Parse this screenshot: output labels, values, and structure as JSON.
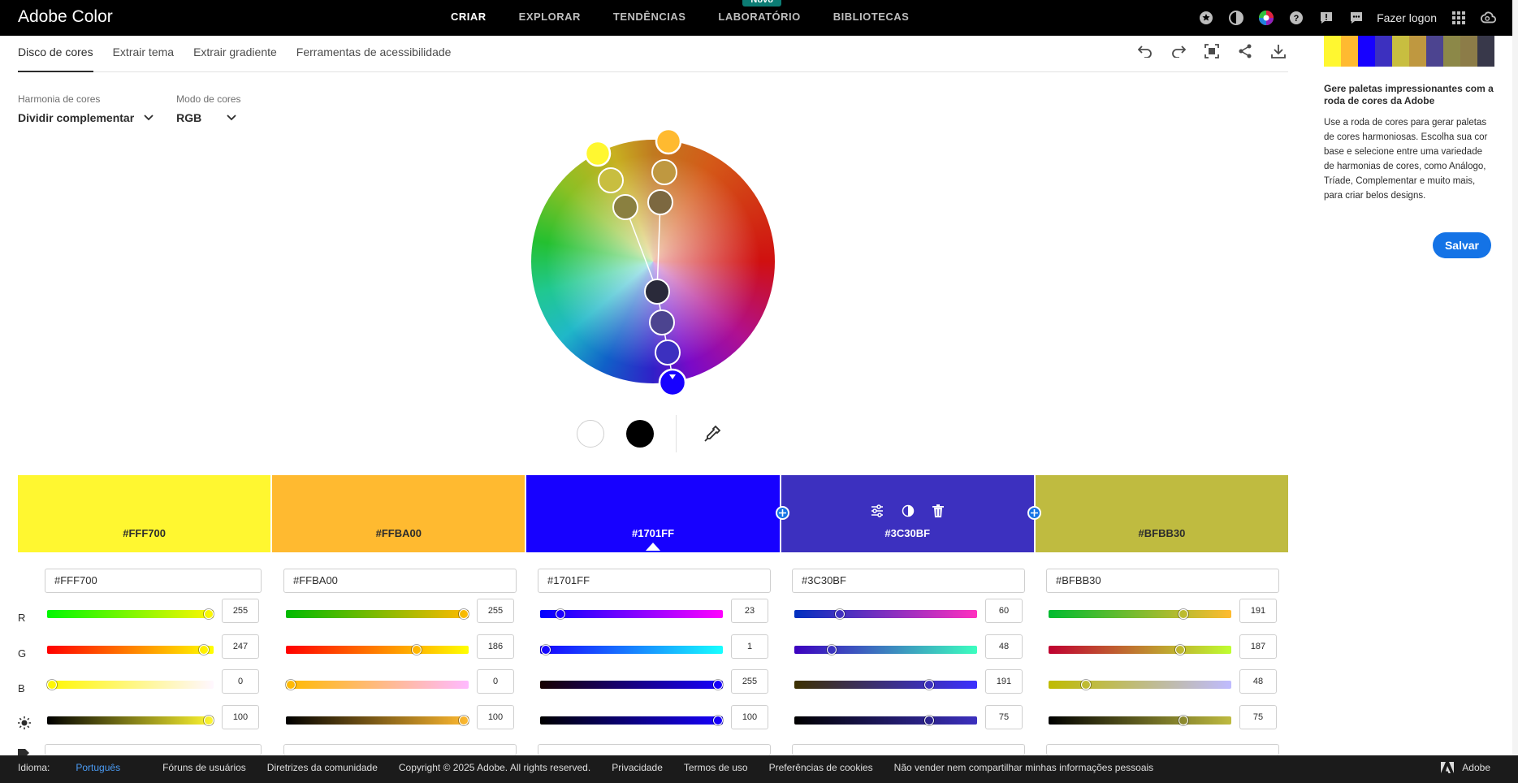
{
  "app": {
    "title": "Adobe Color"
  },
  "topnav": {
    "items": [
      "CRIAR",
      "EXPLORAR",
      "TENDÊNCIAS",
      "LABORATÓRIO",
      "BIBLIOTECAS"
    ],
    "badge": "Novo",
    "login": "Fazer logon",
    "icons": [
      "star-icon",
      "contrast-icon",
      "color-wheel-icon",
      "help-icon",
      "alert-icon",
      "chat-icon",
      "apps-grid-icon",
      "creative-cloud-icon"
    ]
  },
  "tabs": [
    "Disco de cores",
    "Extrair tema",
    "Extrair gradiente",
    "Ferramentas de acessibilidade"
  ],
  "toolbar": {
    "icons": [
      "undo-icon",
      "redo-icon",
      "fit-screen-icon",
      "share-icon",
      "download-icon"
    ]
  },
  "harmony": {
    "label": "Harmonia de cores",
    "value": "Dividir complementar"
  },
  "mode": {
    "label": "Modo de cores",
    "value": "RGB"
  },
  "swatches": [
    {
      "hex": "#FFF700",
      "color": "#FFF730",
      "r": 255,
      "g": 247,
      "b": 0,
      "brightness": 100
    },
    {
      "hex": "#FFBA00",
      "color": "#FFBA30",
      "r": 255,
      "g": 186,
      "b": 0,
      "brightness": 100
    },
    {
      "hex": "#1701FF",
      "color": "#1701FF",
      "r": 23,
      "g": 1,
      "b": 255,
      "brightness": 100
    },
    {
      "hex": "#3C30BF",
      "color": "#3C30BF",
      "r": 60,
      "g": 48,
      "b": 191,
      "brightness": 75
    },
    {
      "hex": "#BFBB30",
      "color": "#BFBB40",
      "r": 191,
      "g": 187,
      "b": 48,
      "brightness": 75
    }
  ],
  "channels": [
    "R",
    "G",
    "B"
  ],
  "side": {
    "mini_palette": [
      "#FFF730",
      "#FFBA30",
      "#1701FF",
      "#3C30BF",
      "#C8BE40",
      "#BF9840",
      "#4C4490",
      "#8C8848",
      "#8C7C48",
      "#38384A"
    ],
    "heading": "Gere paletas impressionantes com a roda de cores da Adobe",
    "text": "Use a roda de cores para gerar paletas de cores harmoniosas. Escolha sua cor base e selecione entre uma variedade de harmonias de cores, como Análogo, Tríade, Complementar e muito mais, para criar belos designs.",
    "save": "Salvar"
  },
  "footer": {
    "lang_label": "Idioma:",
    "lang": "Português",
    "links": [
      "Fóruns de usuários",
      "Diretrizes da comunidade",
      "Copyright © 2025 Adobe. All rights reserved.",
      "Privacidade",
      "Termos de uso",
      "Preferências de cookies",
      "Não vender nem compartilhar minhas informações pessoais"
    ],
    "brand": "Adobe"
  }
}
